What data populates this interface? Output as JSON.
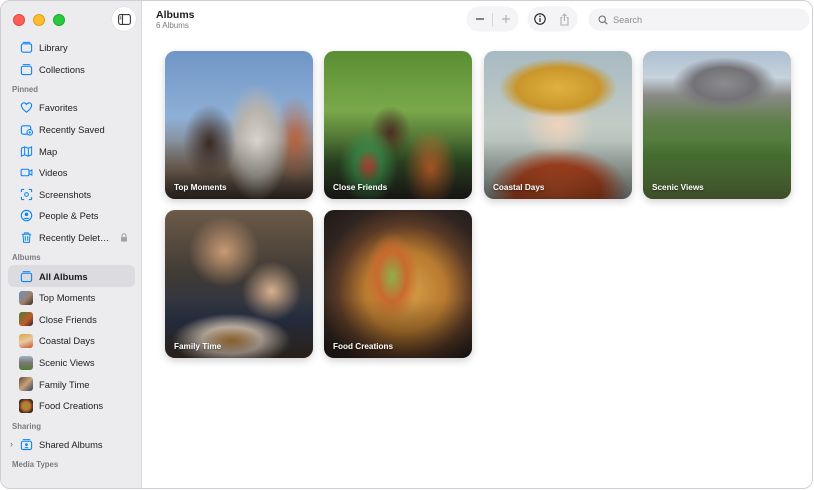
{
  "window": {
    "title": "Albums",
    "subtitle": "6 Albums"
  },
  "toolbar": {
    "zoom_out_icon": "minus-icon",
    "zoom_in_icon": "plus-icon",
    "info_icon": "info-icon",
    "share_icon": "share-icon",
    "search_placeholder": "Search",
    "search_value": ""
  },
  "sidebar": {
    "top_items": [
      {
        "label": "Library",
        "icon": "library-icon"
      },
      {
        "label": "Collections",
        "icon": "collections-icon"
      }
    ],
    "pinned_header": "Pinned",
    "pinned_items": [
      {
        "label": "Favorites",
        "icon": "heart-icon"
      },
      {
        "label": "Recently Saved",
        "icon": "recently-saved-icon"
      },
      {
        "label": "Map",
        "icon": "map-icon"
      },
      {
        "label": "Videos",
        "icon": "video-icon"
      },
      {
        "label": "Screenshots",
        "icon": "screenshot-icon"
      },
      {
        "label": "People & Pets",
        "icon": "person-icon"
      },
      {
        "label": "Recently Delet…",
        "icon": "trash-icon"
      }
    ],
    "albums_header": "Albums",
    "album_items": [
      {
        "label": "All Albums",
        "icon": "albums-icon",
        "selected": true
      },
      {
        "label": "Top Moments"
      },
      {
        "label": "Close Friends"
      },
      {
        "label": "Coastal Days"
      },
      {
        "label": "Scenic Views"
      },
      {
        "label": "Family Time"
      },
      {
        "label": "Food Creations"
      }
    ],
    "sharing_header": "Sharing",
    "sharing_items": [
      {
        "label": "Shared Albums",
        "icon": "shared-albums-icon"
      }
    ],
    "media_header": "Media Types"
  },
  "albums": [
    {
      "name": "Top Moments"
    },
    {
      "name": "Close Friends"
    },
    {
      "name": "Coastal Days"
    },
    {
      "name": "Scenic Views"
    },
    {
      "name": "Family Time"
    },
    {
      "name": "Food Creations"
    }
  ],
  "colors": {
    "accent": "#0a84ff",
    "sidebar_bg": "#ececef",
    "selected_bg": "#dcdce0"
  }
}
